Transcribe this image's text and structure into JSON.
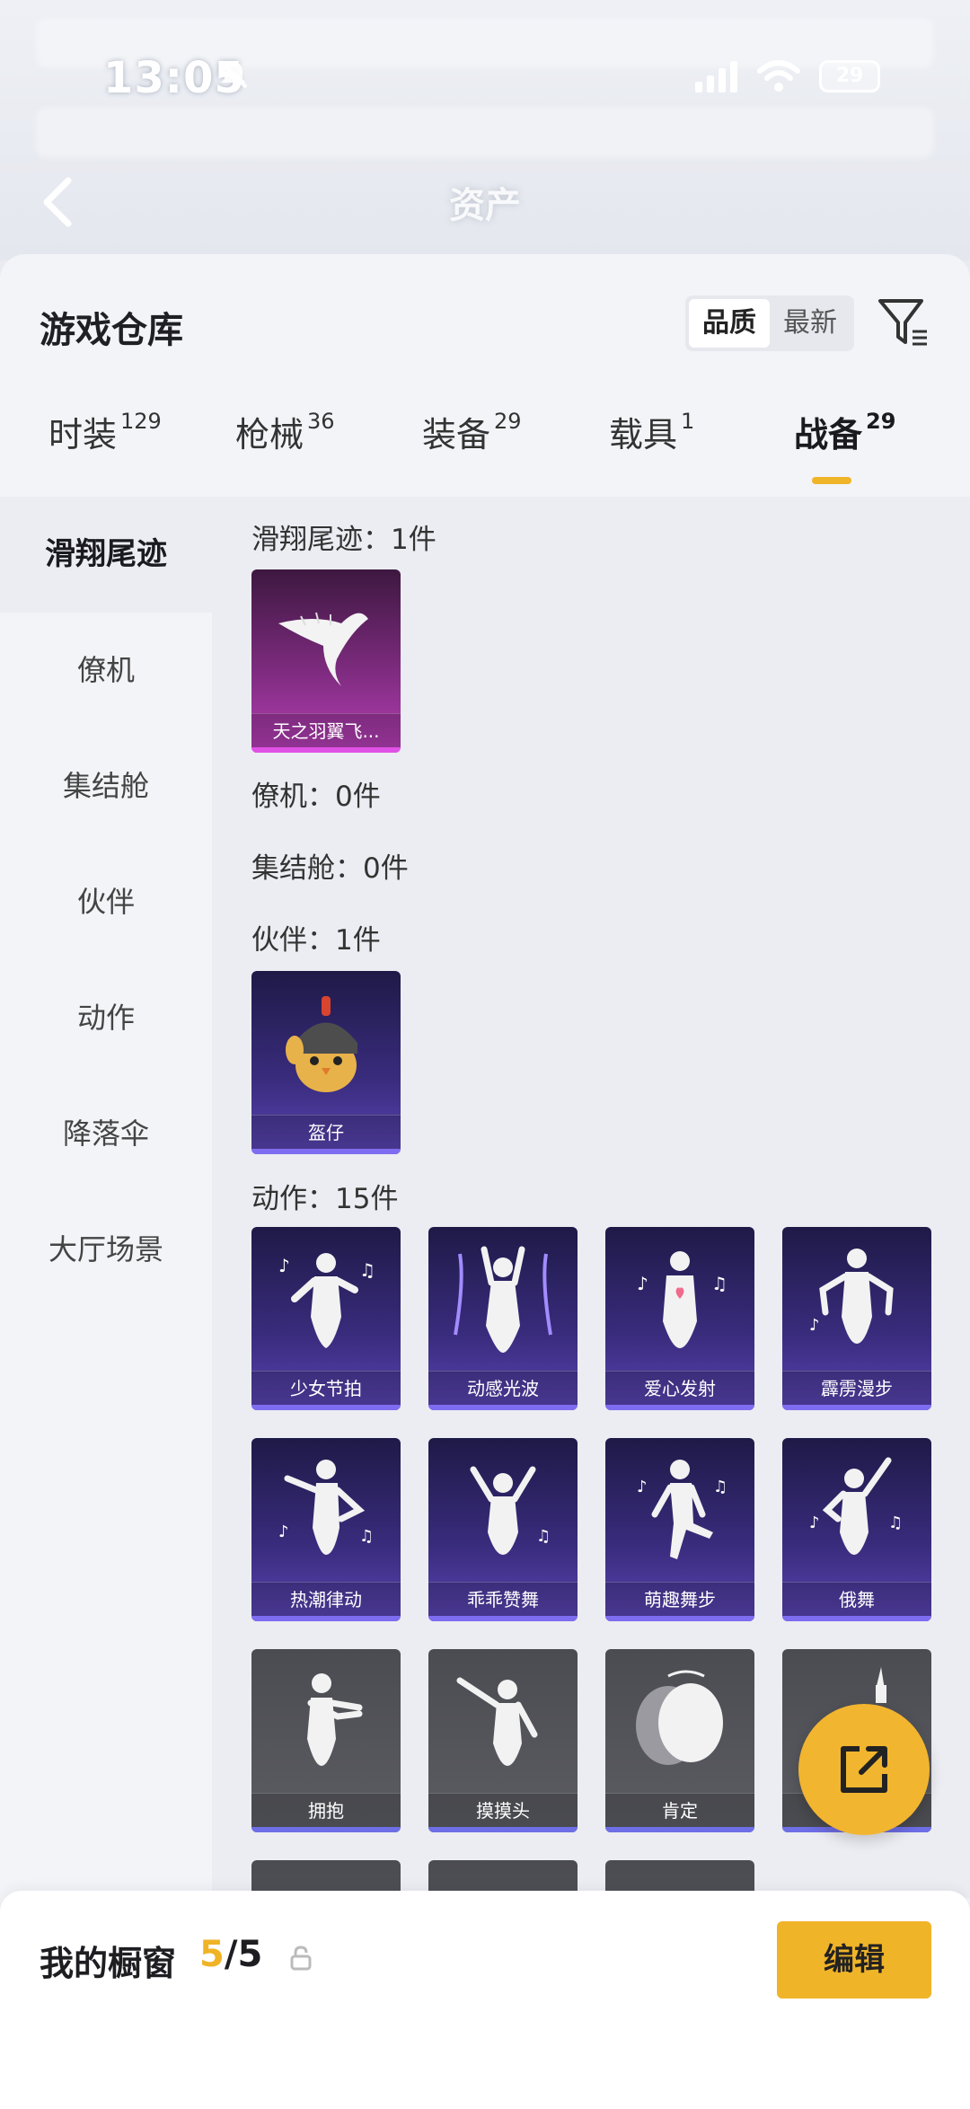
{
  "status_bar": {
    "time": "13:05",
    "battery": "29"
  },
  "header": {
    "title": "资产"
  },
  "sheet": {
    "title": "游戏仓库",
    "sort_options": [
      "品质",
      "最新"
    ],
    "active_sort": "品质"
  },
  "tabs": [
    {
      "label": "时装",
      "count": "129"
    },
    {
      "label": "枪械",
      "count": "36"
    },
    {
      "label": "装备",
      "count": "29"
    },
    {
      "label": "载具",
      "count": "1"
    },
    {
      "label": "战备",
      "count": "29"
    }
  ],
  "active_tab": "战备",
  "side_nav": [
    "滑翔尾迹",
    "僚机",
    "集结舱",
    "伙伴",
    "动作",
    "降落伞",
    "大厅场景"
  ],
  "sections": {
    "glide": {
      "label": "滑翔尾迹：1件",
      "items": [
        "天之羽翼飞..."
      ]
    },
    "wingman": {
      "label": "僚机：0件"
    },
    "pod": {
      "label": "集结舱：0件"
    },
    "partner": {
      "label": "伙伴：1件",
      "items": [
        "盔仔"
      ]
    },
    "emote": {
      "label": "动作：15件",
      "items": [
        "少女节拍",
        "动感光波",
        "爱心发射",
        "霹雳漫步",
        "热潮律动",
        "乖乖赞舞",
        "萌趣舞步",
        "俄舞",
        "拥抱",
        "摸摸头",
        "肯定",
        ""
      ]
    }
  },
  "bottom_bar": {
    "label": "我的橱窗",
    "count_current": "5",
    "count_total": "/5",
    "edit_label": "编辑"
  },
  "colors": {
    "accent": "#f0b429",
    "card_blue": "#3a2c7e",
    "card_purple": "#b53fb6",
    "card_grey": "#5c5d63"
  }
}
